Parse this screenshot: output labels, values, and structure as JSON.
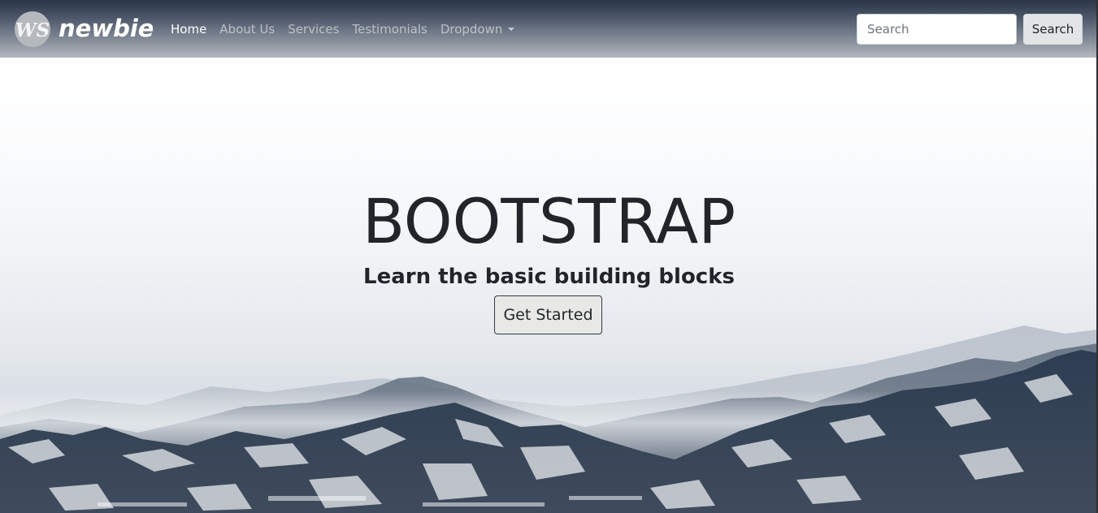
{
  "navbar": {
    "brand_text": "newbie",
    "brand_mark": "WS",
    "links": [
      {
        "label": "Home",
        "active": true
      },
      {
        "label": "About Us",
        "active": false
      },
      {
        "label": "Services",
        "active": false
      },
      {
        "label": "Testimonials",
        "active": false
      },
      {
        "label": "Dropdown",
        "active": false,
        "has_caret": true
      }
    ],
    "search": {
      "placeholder": "Search",
      "button_label": "Search"
    }
  },
  "hero": {
    "title": "BOOTSTRAP",
    "subtitle": "Learn the basic building blocks",
    "cta_label": "Get Started",
    "background": "snowy-mountains"
  },
  "colors": {
    "navbar_top": "#2a3547",
    "navbar_bottom": "#b4b9bf",
    "text_dark": "#212529",
    "mountain_dark": "#2b3a4f"
  }
}
